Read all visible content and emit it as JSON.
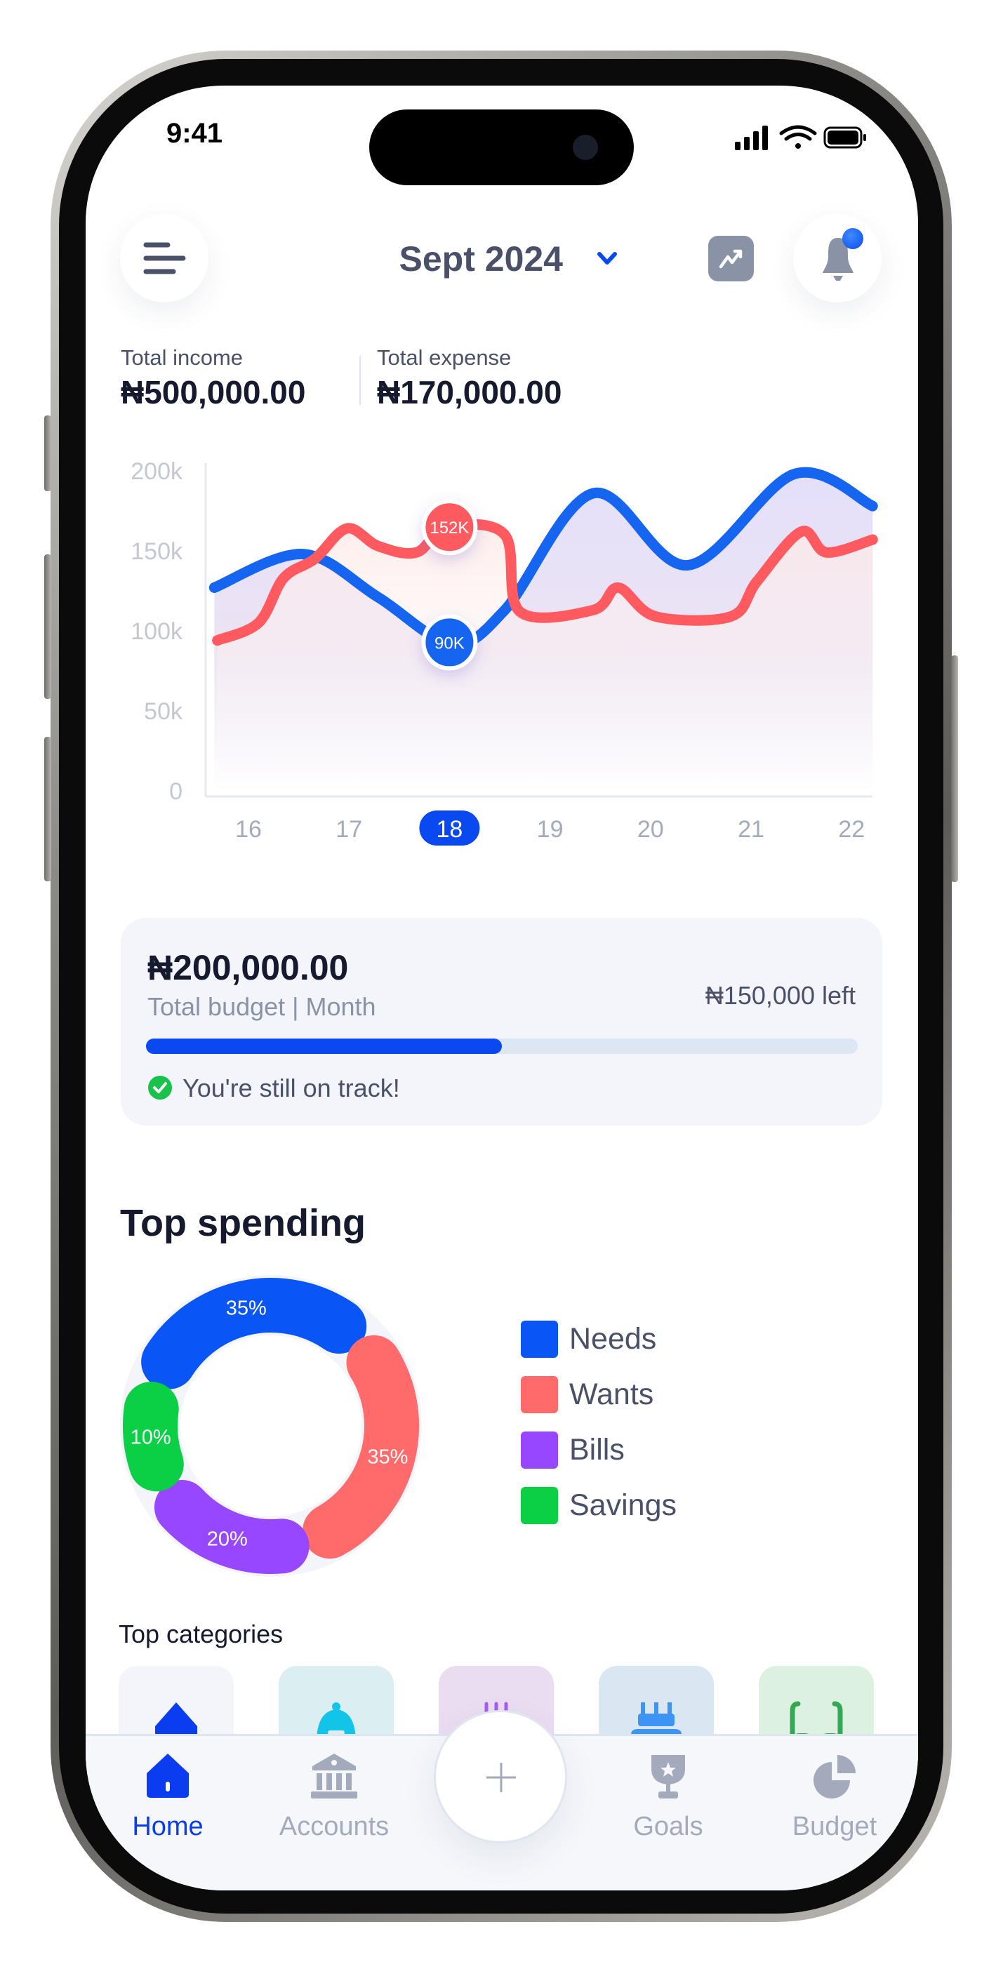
{
  "status_bar": {
    "time": "9:41"
  },
  "header": {
    "month": "Sept 2024",
    "menu_icon": "menu-icon",
    "chevron_icon": "chevron-down-icon",
    "trend_icon": "trending-up-icon",
    "bell_icon": "bell-icon",
    "accent": "#0a49f0"
  },
  "totals": {
    "income_label": "Total income",
    "income_value": "₦500,000.00",
    "expense_label": "Total expense",
    "expense_value": "₦170,000.00"
  },
  "chart_data": {
    "type": "line",
    "y_ticks": [
      "200k",
      "150k",
      "100k",
      "50k",
      "0"
    ],
    "ylim": [
      0,
      200000
    ],
    "x_ticks": [
      "16",
      "17",
      "18",
      "19",
      "20",
      "21",
      "22"
    ],
    "selected_x": "18",
    "grid": false,
    "series": [
      {
        "color": "#1565f0",
        "x": [
          15.66,
          16.54,
          17.29,
          18.02,
          18.55,
          19.43,
          20.37,
          21.43,
          22.21
        ],
        "y": [
          127000,
          148000,
          121000,
          92000,
          113000,
          186000,
          141000,
          198000,
          178000
        ],
        "marker_label": "90K"
      },
      {
        "color": "#ff5a5f",
        "x": [
          15.69,
          16.1,
          16.35,
          16.66,
          16.98,
          17.29,
          17.67,
          17.98,
          18.55,
          18.7,
          19.43,
          19.68,
          20.05,
          20.8,
          21.06,
          21.5,
          21.75,
          22.21
        ],
        "y": [
          94000,
          105000,
          133000,
          145000,
          164000,
          153000,
          149000,
          165000,
          160000,
          112000,
          113000,
          127000,
          109000,
          109000,
          131000,
          162000,
          149000,
          157000
        ],
        "marker_label": "152K"
      }
    ]
  },
  "budget": {
    "amount": "₦200,000.00",
    "label": "Total budget | Month",
    "left": "₦150,000 left",
    "progress": 0.5,
    "status": "You're still on track!",
    "progress_color": "#0a49f0",
    "track_color": "#dde6f3"
  },
  "top_spending": {
    "title": "Top spending",
    "segments": [
      {
        "name": "Needs",
        "percent": 35,
        "label": "35%",
        "color": "#0a55f5"
      },
      {
        "name": "Wants",
        "percent": 35,
        "label": "35%",
        "color": "#ff6b6b"
      },
      {
        "name": "Bills",
        "percent": 20,
        "label": "20%",
        "color": "#9747ff"
      },
      {
        "name": "Savings",
        "percent": 10,
        "label": "10%",
        "color": "#0bcf45"
      }
    ]
  },
  "top_categories": {
    "title": "Top categories",
    "tiles": [
      {
        "icon": "house-icon",
        "bg": "#f3f5fa",
        "color": "#0a3df0"
      },
      {
        "icon": "food-cloche-icon",
        "bg": "#dbeef2",
        "color": "#12c4e8"
      },
      {
        "icon": "utility-icon",
        "bg": "#eadcf1",
        "color": "#a45cf5"
      },
      {
        "icon": "cake-icon",
        "bg": "#dbe6f3",
        "color": "#3d94f5"
      },
      {
        "icon": "glasses-icon",
        "bg": "#dcf1e0",
        "color": "#35a853"
      }
    ]
  },
  "bottom_nav": {
    "items": [
      {
        "label": "Home",
        "icon": "home-icon",
        "active": true
      },
      {
        "label": "Accounts",
        "icon": "bank-icon"
      },
      {
        "label": "Goals",
        "icon": "trophy-icon"
      },
      {
        "label": "Budget",
        "icon": "pie-chart-icon"
      }
    ],
    "add_icon": "plus-icon"
  }
}
